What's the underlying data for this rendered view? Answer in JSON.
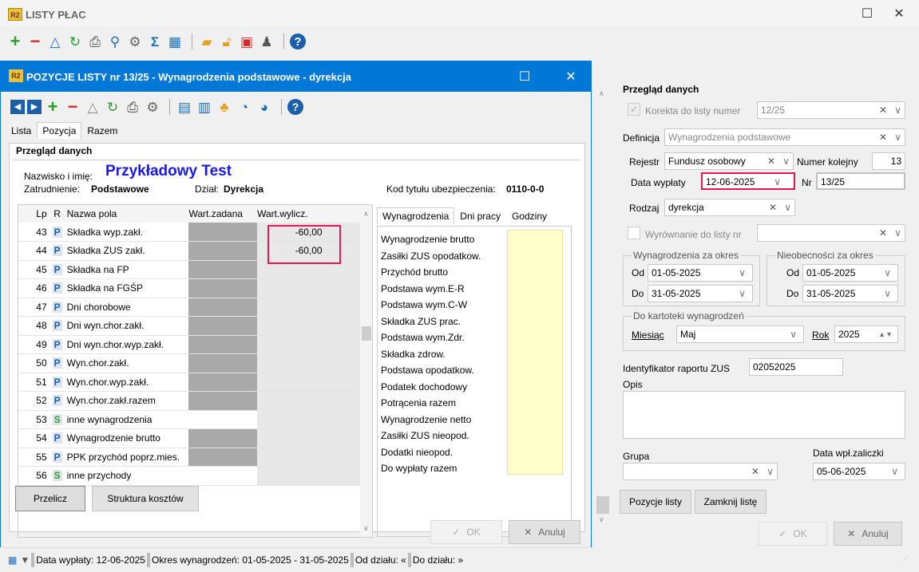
{
  "app": {
    "title": "LISTY PŁAC",
    "logo": "R2"
  },
  "main_toolbar": {
    "icons": [
      "plus-icon",
      "minus-icon",
      "delta-icon",
      "refresh-icon",
      "print-icon",
      "search-icon",
      "settings-icon",
      "sum-icon",
      "grid-icon",
      "folder-icon",
      "unlock-icon",
      "export-icon",
      "users-icon",
      "help-icon"
    ]
  },
  "dialog": {
    "title": "POZYCJE LISTY nr 13/25 - Wynagrodzenia podstawowe - dyrekcja",
    "tabs": [
      "Lista",
      "Pozycja",
      "Razem"
    ],
    "active_tab": "Pozycja",
    "section_title": "Przegląd danych",
    "name_label": "Nazwisko i imię:",
    "name_value": "Przykładowy Test",
    "employment_label": "Zatrudnienie:",
    "employment_value": "Podstawowe",
    "dept_label": "Dział:",
    "dept_value": "Dyrekcja",
    "insurance_label": "Kod tytułu ubezpieczenia:",
    "insurance_value": "0110-0-0",
    "grid_headers": {
      "lp": "Lp",
      "r": "R",
      "name": "Nazwa pola",
      "set": "Wart.zadana",
      "calc": "Wart.wylicz."
    },
    "rows": [
      {
        "lp": "43",
        "r": "P",
        "name": "Składka wyp.zakł.",
        "set": "",
        "calc": "-60,00",
        "set_gray": true
      },
      {
        "lp": "44",
        "r": "P",
        "name": "Składka ZUS zakł.",
        "set": "",
        "calc": "-60,00",
        "set_gray": true
      },
      {
        "lp": "45",
        "r": "P",
        "name": "Składka na FP",
        "set": "",
        "calc": "",
        "set_gray": true
      },
      {
        "lp": "46",
        "r": "P",
        "name": "Składka na FGŚP",
        "set": "",
        "calc": "",
        "set_gray": true
      },
      {
        "lp": "47",
        "r": "P",
        "name": "Dni chorobowe",
        "set": "",
        "calc": "",
        "set_gray": true
      },
      {
        "lp": "48",
        "r": "P",
        "name": "Dni wyn.chor.zakł.",
        "set": "",
        "calc": "",
        "set_gray": true
      },
      {
        "lp": "49",
        "r": "P",
        "name": "Dni wyn.chor.wyp.zakł.",
        "set": "",
        "calc": "",
        "set_gray": true
      },
      {
        "lp": "50",
        "r": "P",
        "name": "Wyn.chor.zakł.",
        "set": "",
        "calc": "",
        "set_gray": true
      },
      {
        "lp": "51",
        "r": "P",
        "name": "Wyn.chor.wyp.zakł.",
        "set": "",
        "calc": "",
        "set_gray": true
      },
      {
        "lp": "52",
        "r": "P",
        "name": "Wyn.chor.zakł.razem",
        "set": "",
        "calc": "",
        "set_gray": true
      },
      {
        "lp": "53",
        "r": "S",
        "name": "inne wynagrodzenia",
        "set": "",
        "calc": "",
        "set_gray": false
      },
      {
        "lp": "54",
        "r": "P",
        "name": "Wynagrodzenie brutto",
        "set": "",
        "calc": "",
        "set_gray": true
      },
      {
        "lp": "55",
        "r": "P",
        "name": "PPK przychód poprz.mies.",
        "set": "",
        "calc": "",
        "set_gray": true
      },
      {
        "lp": "56",
        "r": "S",
        "name": "inne przychody",
        "set": "",
        "calc": "",
        "set_gray": false
      }
    ],
    "side_tabs": [
      "Wynagrodzenia",
      "Dni pracy",
      "Godziny"
    ],
    "side_items": [
      "Wynagrodzenie brutto",
      "Zasiłki ZUS opodatkow.",
      "Przychód brutto",
      "Podstawa wym.E-R",
      "Podstawa wym.C-W",
      "Składka ZUS prac.",
      "Podstawa wym.Zdr.",
      "Składka zdrow.",
      "Podstawa opodatkow.",
      "Podatek dochodowy",
      "Potrącenia razem",
      "Wynagrodzenie netto",
      "Zasiłki ZUS nieopod.",
      "Dodatki nieopod.",
      "Do wypłaty razem"
    ],
    "recalc_button": "Przelicz",
    "cost_button": "Struktura kosztów",
    "ok_button": "OK",
    "cancel_button": "Anuluj"
  },
  "status": {
    "pay_date": "Data wypłaty: 12-06-2025",
    "period": "Okres wynagrodzeń: 01-05-2025 - 31-05-2025",
    "from_dept": "Od działu: «",
    "to_dept": "Do działu: »"
  },
  "right": {
    "section_title": "Przegląd danych",
    "correction_label": "Korekta do listy numer",
    "correction_value": "12/25",
    "definition_label": "Definicja",
    "definition_value": "Wynagrodzenia podstawowe",
    "register_label": "Rejestr",
    "register_value": "Fundusz osobowy",
    "seq_label": "Numer kolejny",
    "seq_value": "13",
    "paydate_label": "Data wypłaty",
    "paydate_value": "12-06-2025",
    "nr_label": "Nr",
    "nr_value": "13/25",
    "kind_label": "Rodzaj",
    "kind_value": "dyrekcja",
    "equalize_label": "Wyrównanie do listy nr",
    "equalize_value": "",
    "wages_group": "Wynagrodzenia za okres",
    "absence_group": "Nieobecności za okres",
    "from_label": "Od",
    "to_label": "Do",
    "wages_from": "01-05-2025",
    "wages_to": "31-05-2025",
    "abs_from": "01-05-2025",
    "abs_to": "31-05-2025",
    "file_group": "Do kartoteki wynagrodzeń",
    "month_label": "Miesiąc",
    "month_value": "Maj",
    "year_label": "Rok",
    "year_value": "2025",
    "zus_label": "Identyfikator raportu ZUS",
    "zus_value": "02052025",
    "desc_label": "Opis",
    "group_label": "Grupa",
    "advance_label": "Data wpł.zaliczki",
    "advance_value": "05-06-2025",
    "items_button": "Pozycje listy",
    "close_button": "Zamknij listę",
    "ok_button": "OK",
    "cancel_button": "Anuluj"
  },
  "colors": {
    "accent": "#0078d7",
    "highlight": "#e8174d",
    "name_blue": "#1a1ae6",
    "gray_cell": "#a9a9a9",
    "yellow_cell": "#ffffcc"
  }
}
